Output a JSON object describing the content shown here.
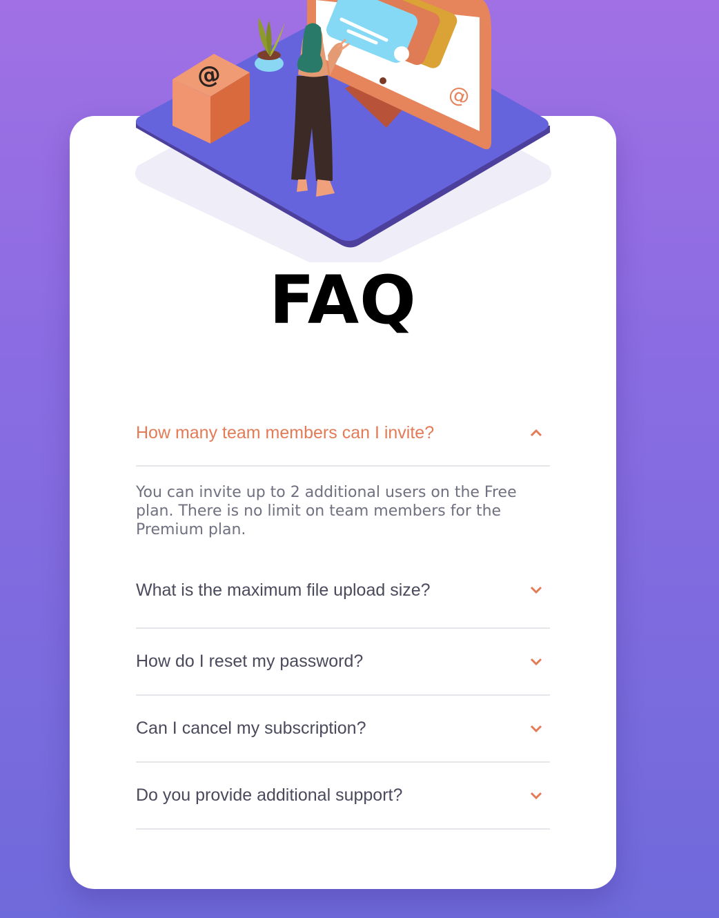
{
  "page": {
    "title": "FAQ"
  },
  "faq": {
    "items": [
      {
        "question": "How many team members can I invite?",
        "answer": "You can invite up to 2 additional users on the Free plan. There is no limit on team members for the Premium plan.",
        "open": true
      },
      {
        "question": "What is the maximum file upload size?",
        "open": false
      },
      {
        "question": "How do I reset my password?",
        "open": false
      },
      {
        "question": "Can I cancel my subscription?",
        "open": false
      },
      {
        "question": "Do you provide additional support?",
        "open": false
      }
    ]
  },
  "icons": {
    "expanded": "chevron-up-icon",
    "collapsed": "chevron-down-icon"
  },
  "colors": {
    "accent": "#e27b56",
    "question_text": "#4a4a5c",
    "answer_text": "#6f7080",
    "divider": "#e6e6ea",
    "background_top": "#a070e4",
    "background_bottom": "#6f6adb"
  }
}
